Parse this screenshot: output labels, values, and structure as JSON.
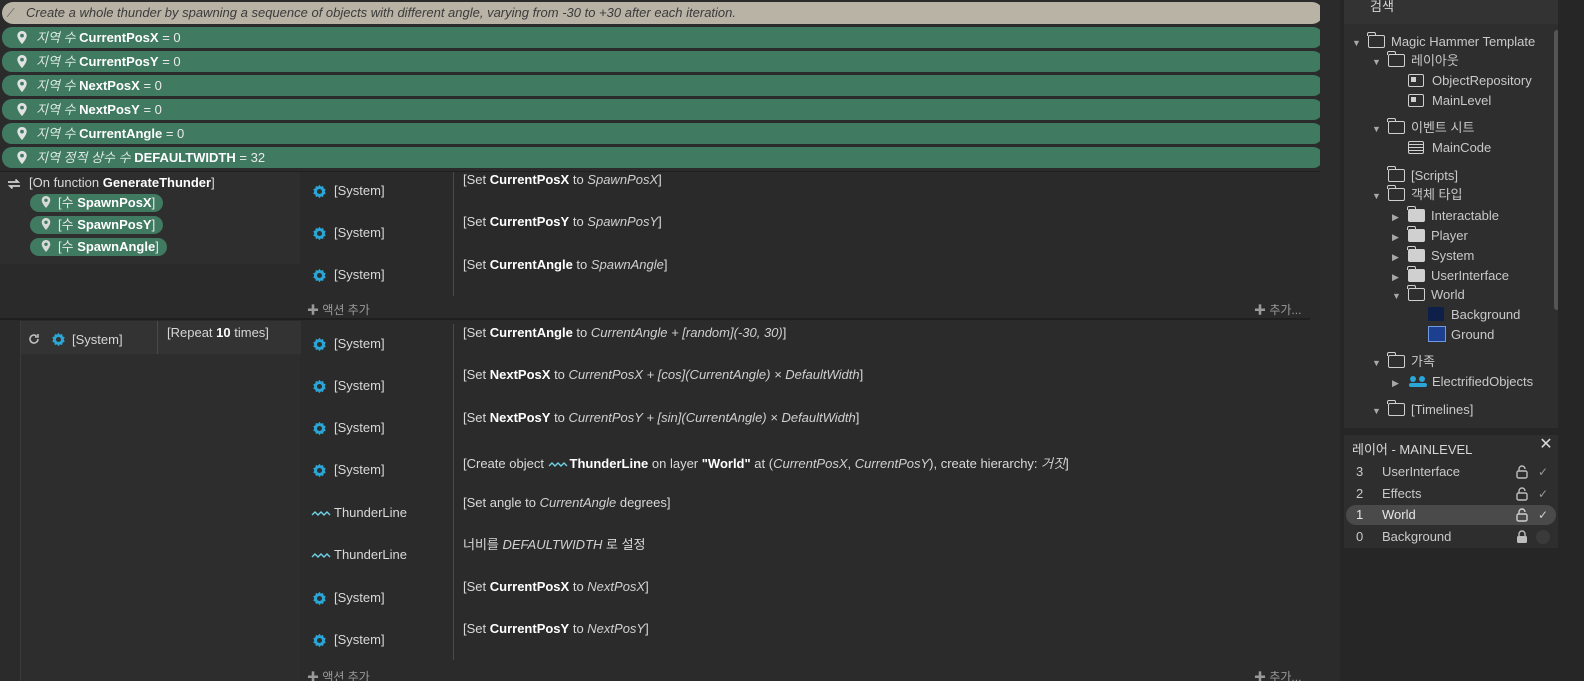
{
  "comment": "Create a whole thunder by spawning a sequence of objects with different angle, varying from -30 to +30 after each iteration.",
  "variables": [
    {
      "prefix": "지역 수",
      "name": "CurrentPosX",
      "suffix": "= 0"
    },
    {
      "prefix": "지역 수",
      "name": "CurrentPosY",
      "suffix": "= 0"
    },
    {
      "prefix": "지역 수",
      "name": "NextPosX",
      "suffix": "= 0"
    },
    {
      "prefix": "지역 수",
      "name": "NextPosY",
      "suffix": "= 0"
    },
    {
      "prefix": "지역 수",
      "name": "CurrentAngle",
      "suffix": "= 0"
    },
    {
      "prefix": "지역 정적 상수 수",
      "name": "DEFAULTWIDTH",
      "suffix": "= 32"
    }
  ],
  "function_block": {
    "header_pre": "[On function ",
    "header_name": "GenerateThunder",
    "header_post": "]",
    "params": [
      {
        "pre": "[수 ",
        "name": "SpawnPosX",
        "post": "]"
      },
      {
        "pre": "[수 ",
        "name": "SpawnPosY",
        "post": "]"
      },
      {
        "pre": "[수 ",
        "name": "SpawnAngle",
        "post": "]"
      }
    ],
    "actions": [
      {
        "object": "[System]",
        "a": "[Set ",
        "b": "CurrentPosX",
        "c": " to ",
        "d": "SpawnPosX",
        "e": "]"
      },
      {
        "object": "[System]",
        "a": "[Set ",
        "b": "CurrentPosY",
        "c": " to ",
        "d": "SpawnPosY",
        "e": "]"
      },
      {
        "object": "[System]",
        "a": "[Set ",
        "b": "CurrentAngle",
        "c": " to ",
        "d": "SpawnAngle",
        "e": "]"
      }
    ],
    "add_action": "액션 추가",
    "add_more": "추가..."
  },
  "repeat_block": {
    "cond_object": "[System]",
    "cond_pre": "[Repeat ",
    "cond_count": "10",
    "cond_post": " times]",
    "actions": [
      {
        "object": "[System]",
        "a": "[Set ",
        "b": "CurrentAngle",
        "c": " to ",
        "d": "CurrentAngle + [random](-30, 30)",
        "e": "]"
      },
      {
        "object": "[System]",
        "a": "[Set ",
        "b": "NextPosX",
        "c": " to ",
        "d": "CurrentPosX + [cos](CurrentAngle) × DefaultWidth",
        "e": "]"
      },
      {
        "object": "[System]",
        "a": "[Set ",
        "b": "NextPosY",
        "c": " to ",
        "d": "CurrentPosY + [sin](CurrentAngle) × DefaultWidth",
        "e": "]"
      },
      {
        "object": "[System]",
        "create": {
          "a": "[Create object ",
          "obj": "ThunderLine",
          "b": " on layer ",
          "layer": "\"World\"",
          "c": " at (",
          "x": "CurrentPosX",
          "sep": ", ",
          "y": "CurrentPosY",
          "d": "), create hierarchy: ",
          "h": "거짓",
          "e": "]"
        }
      },
      {
        "object": "ThunderLine",
        "a": "[Set angle to ",
        "b": "",
        "c": "",
        "d": "CurrentAngle",
        "e": " degrees]"
      },
      {
        "object": "ThunderLine",
        "a": "너비를 ",
        "b": "",
        "c": "",
        "d": "DEFAULTWIDTH",
        "e": " 로 설정"
      },
      {
        "object": "[System]",
        "a": "[Set ",
        "b": "CurrentPosX",
        "c": " to ",
        "d": "NextPosX",
        "e": "]"
      },
      {
        "object": "[System]",
        "a": "[Set ",
        "b": "CurrentPosY",
        "c": " to ",
        "d": "NextPosY",
        "e": "]"
      }
    ],
    "add_action": "액션 추가",
    "add_more": "추가..."
  },
  "project": {
    "search_label": "검색",
    "items": [
      {
        "label": "Magic Hammer Template",
        "icon": "folder-icon"
      },
      {
        "label": "레이아웃",
        "icon": "folder-icon"
      },
      {
        "label": "ObjectRepository",
        "icon": "layout-icon"
      },
      {
        "label": "MainLevel",
        "icon": "layout-icon"
      },
      {
        "label": "이벤트 시트",
        "icon": "folder-icon"
      },
      {
        "label": "MainCode",
        "icon": "event-sheet-icon"
      },
      {
        "label": "[Scripts]",
        "icon": "folder-icon"
      },
      {
        "label": "객체 타입",
        "icon": "folder-icon"
      },
      {
        "label": "Interactable",
        "icon": "folder-filled-icon"
      },
      {
        "label": "Player",
        "icon": "folder-filled-icon"
      },
      {
        "label": "System",
        "icon": "folder-filled-icon"
      },
      {
        "label": "UserInterface",
        "icon": "folder-filled-icon"
      },
      {
        "label": "World",
        "icon": "folder-icon"
      },
      {
        "label": "Background",
        "icon": "sprite-icon"
      },
      {
        "label": "Ground",
        "icon": "tilemap-icon"
      },
      {
        "label": "가족",
        "icon": "folder-icon"
      },
      {
        "label": "ElectrifiedObjects",
        "icon": "family-icon"
      },
      {
        "label": "[Timelines]",
        "icon": "folder-icon"
      }
    ]
  },
  "layers": {
    "title": "레이어 - MAINLEVEL",
    "rows": [
      {
        "num": "3",
        "name": "UserInterface"
      },
      {
        "num": "2",
        "name": "Effects"
      },
      {
        "num": "1",
        "name": "World"
      },
      {
        "num": "0",
        "name": "Background"
      }
    ]
  },
  "colors": {
    "variable_bg": "#3f7a61",
    "comment_bg": "#b9b3a6",
    "gear": "#2aa7d6"
  }
}
